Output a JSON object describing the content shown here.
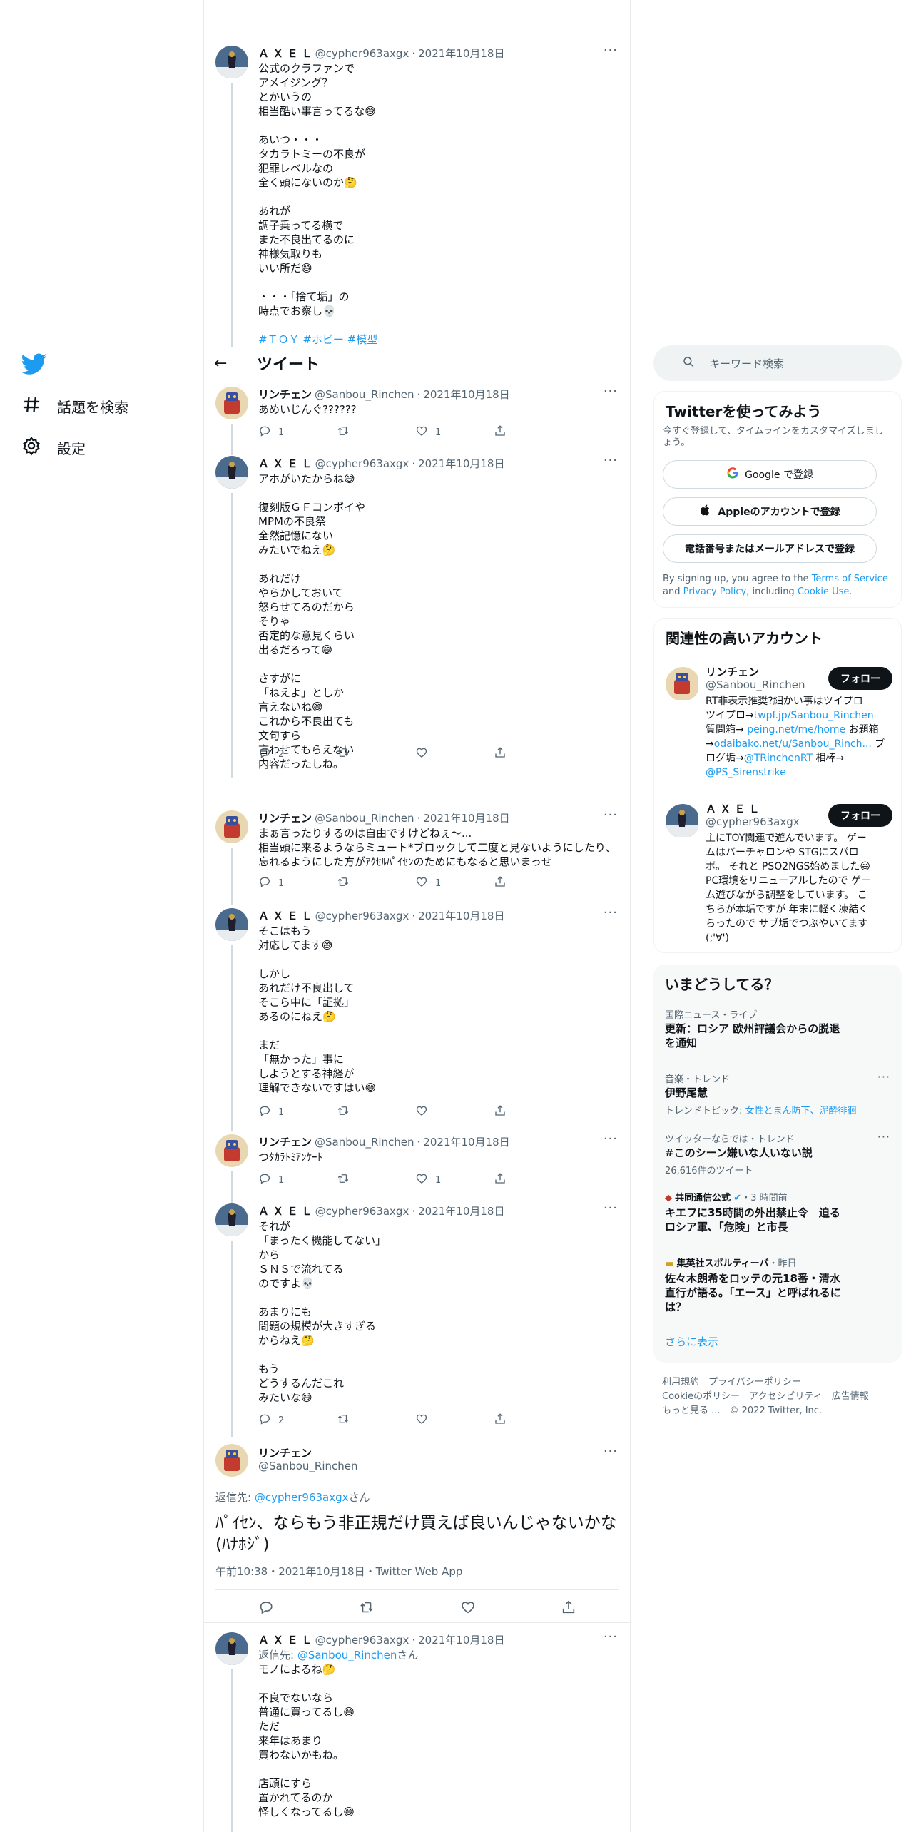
{
  "nav": {
    "explore": "話題を検索",
    "settings": "設定"
  },
  "header": {
    "back": "←",
    "title": "ツイート"
  },
  "tweets": [
    {
      "name": "Ａ Ｘ Ｅ Ｌ",
      "handle": "@cypher963axgx",
      "date": "2021年10月18日",
      "text": "公式のクラファンで\nアメイジング？\nとかいうの\n相当酷い事言ってるな😅\n\nあいつ・・・\nタカラトミーの不良が\n犯罪レベルなの\n全く頭にないのか🤔\n\nあれが\n調子乗ってる横で\nまた不良出てるのに\n神様気取りも\nいい所だ😅\n\n・・・「捨て垢」の\n時点でお察し💀",
      "tags": "#ＴＯＹ #ホビー #模型"
    },
    {
      "name": "リンチェン",
      "handle": "@Sanbou_Rinchen",
      "date": "2021年10月18日",
      "text": "あめいじんぐ??????",
      "replies": "1",
      "retweets": "",
      "likes": "1"
    },
    {
      "name": "Ａ Ｘ Ｅ Ｌ",
      "handle": "@cypher963axgx",
      "date": "2021年10月18日",
      "text": "アホがいたからね😅\n\n復刻版ＧＦコンボイや\nMPMの不良祭\n全然記憶にない\nみたいでねえ🤔\n\nあれだけ\nやらかしておいて\n怒らせてるのだから\nそりゃ\n否定的な意見くらい\n出るだろって😅\n\nさすがに\n「ねえよ」としか\n言えないね😅\nこれから不良出ても\n文句すら\n言わせてもらえない\n内容だったしね。",
      "replies": "2",
      "retweets": "",
      "likes": ""
    },
    {
      "name": "リンチェン",
      "handle": "@Sanbou_Rinchen",
      "date": "2021年10月18日",
      "text": "まぁ言ったりするのは自由ですけどねぇ〜...\n相当頭に来るようならミュート*ブロックして二度と見ないようにしたり、\n忘れるようにした方がｱｸｾﾙﾊﾟｲｾﾝのためにもなると思いまっせ",
      "replies": "1",
      "retweets": "",
      "likes": "1"
    },
    {
      "name": "Ａ Ｘ Ｅ Ｌ",
      "handle": "@cypher963axgx",
      "date": "2021年10月18日",
      "text": "そこはもう\n対応してます😅\n\nしかし\nあれだけ不良出して\nそこら中に「証拠」\nあるのにねえ🤔\n\nまだ\n「無かった」事に\nしようとする神経が\n理解できないですはい😅",
      "replies": "1",
      "retweets": "",
      "likes": ""
    },
    {
      "name": "リンチェン",
      "handle": "@Sanbou_Rinchen",
      "date": "2021年10月18日",
      "text": "つﾀｶﾗﾄﾐｱﾝｹｰﾄ",
      "replies": "1",
      "retweets": "",
      "likes": "1"
    },
    {
      "name": "Ａ Ｘ Ｅ Ｌ",
      "handle": "@cypher963axgx",
      "date": "2021年10月18日",
      "text": "それが\n「まったく機能してない」\nから\nＳＮＳで流れてる\nのですよ💀\n\nあまりにも\n問題の規模が大きすぎる\nからねえ🤔\n\nもう\nどうするんだこれ\nみたいな😅",
      "replies": "2",
      "retweets": "",
      "likes": ""
    },
    {
      "name": "Ａ Ｘ Ｅ Ｌ",
      "handle": "@cypher963axgx",
      "date": "2021年10月18日",
      "reply_prefix": "返信先:",
      "reply_to": "@Sanbou_Rinchen",
      "reply_suffix": "さん",
      "text": "モノによるね🤔\n\n不良でないなら\n普通に買ってるし😅\nただ\n来年はあまり\n買わないかもね。\n\n店頭にすら\n置かれてるのか\n怪しくなってるし😅"
    }
  ],
  "focal": {
    "name": "リンチェン",
    "handle": "@Sanbou_Rinchen",
    "reply_prefix": "返信先:",
    "reply_to": "@cypher963axgx",
    "reply_suffix": "さん",
    "text": "ﾊﾟｲｾﾝ、ならもう非正規だけ買えば良いんじゃないかな(ﾊﾅﾎｼﾞ)",
    "meta": "午前10:38・2021年10月18日・Twitter Web App"
  },
  "search": {
    "placeholder": "キーワード検索"
  },
  "signup": {
    "title": "Twitterを使ってみよう",
    "subtitle": "今すぐ登録して、タイムラインをカスタマイズしましょう。",
    "google": "Google で登録",
    "apple": "Appleのアカウントで登録",
    "phone": "電話番号またはメールアドレスで登録",
    "legal_1": "By signing up, you agree to the",
    "terms": "Terms of Service",
    "legal_2": "and",
    "privacy": "Privacy Policy",
    "legal_3": ", including",
    "cookie": "Cookie Use."
  },
  "related": {
    "title": "関連性の高いアカウント",
    "follow": "フォロー",
    "accounts": [
      {
        "name": "リンチェン",
        "handle": "@Sanbou_Rinchen",
        "bio": [
          "RT非表示推奨?細かい事はツイプロ",
          "ツイプロ→twpf.jp/Sanbou_Rinchen",
          "質問箱→ peing.net/me/home お題箱",
          "→odaibako.net/u/Sanbou_Rinch... ブ",
          "ログ垢→@TRinchenRT 相棒→",
          "@PS_Sirenstrike"
        ]
      },
      {
        "name": "Ａ Ｘ Ｅ Ｌ",
        "handle": "@cypher963axgx",
        "bio": [
          "主にTOY関連で遊んでいます。 ゲー",
          "ムはバーチャロンや STGにスパロ",
          "ボ。 それと PSO2NGS始めました😃",
          "PC環境をリニューアルしたので ゲー",
          "ム遊びながら調整をしています。 こ",
          "ちらが本垢ですが 年末に軽く凍結く",
          "らったので サブ垢でつぶやいてます",
          "(;'∀')"
        ]
      }
    ]
  },
  "trends": {
    "title": "いまどうしてる？",
    "items": [
      {
        "category": "国際ニュース・ライブ",
        "title": "更新：ロシア 欧州評議会からの脱退を通知"
      },
      {
        "category": "音楽・トレンド",
        "title": "伊野尾慧",
        "sub_prefix": "トレンドトピック:",
        "sub_links": "女性とまん防下、泥酔徘徊"
      },
      {
        "category": "ツイッターならでは・トレンド",
        "title": "#このシーン嫌いな人いない説",
        "sub": "26,616件のツイート"
      },
      {
        "source": "共同通信公式",
        "time": "・3 時間前",
        "title": "キエフに35時間の外出禁止令　迫るロシア軍、「危険」と市長"
      },
      {
        "source": "集英社スポルティーバ",
        "time": "・昨日",
        "title": "佐々木朗希をロッテの元18番・清水直行が語る。「エース」と呼ばれるには？"
      }
    ],
    "show_more": "さらに表示"
  },
  "footer": {
    "line1": "利用規約　プライバシーポリシー",
    "line2": "Cookieのポリシー　アクセシビリティ　広告情報",
    "line3": "もっと見る ...　© 2022 Twitter, Inc."
  },
  "colors": {
    "accent": "#1d9bf0",
    "text": "#0f1419",
    "muted": "#536471"
  }
}
